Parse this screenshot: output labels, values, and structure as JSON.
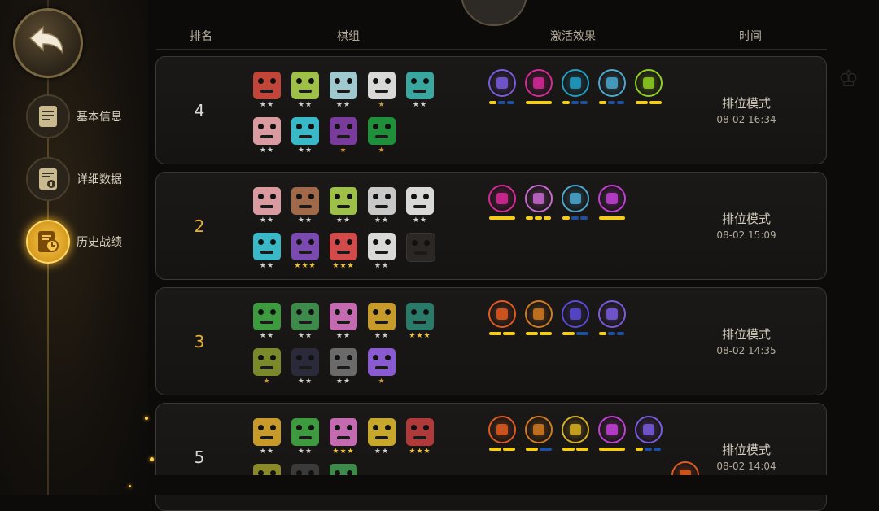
{
  "sidebar": {
    "back": "back",
    "items": [
      {
        "label": "基本信息",
        "icon": "doc-icon",
        "active": false
      },
      {
        "label": "详细数据",
        "icon": "info-doc-icon",
        "active": false
      },
      {
        "label": "历史战绩",
        "icon": "history-icon",
        "active": true
      }
    ]
  },
  "headers": {
    "rank": "排名",
    "lineup": "棋组",
    "synergy": "激活效果",
    "time": "时间"
  },
  "colors": {
    "accent_gold": "#f0b02a",
    "rank_gold": "#e4b032",
    "bar_yellow": "#f3cd1a",
    "bar_blue": "#1f4f9f"
  },
  "matches": [
    {
      "rank": "4",
      "highlight": false,
      "mode": "排位模式",
      "time": "08-02 16:34",
      "pieces": [
        {
          "c": "#c2453a",
          "stars": "★★",
          "star_color": "#cfcfcf"
        },
        {
          "c": "#9fc048",
          "stars": "★★",
          "star_color": "#cfcfcf"
        },
        {
          "c": "#9fc9cf",
          "stars": "★★",
          "star_color": "#cfcfcf"
        },
        {
          "c": "#d9dad8",
          "stars": "★",
          "star_color": "#c8913a"
        },
        {
          "c": "#3aa6a0",
          "stars": "★★",
          "star_color": "#cfcfcf"
        },
        {
          "c": "#d99aa0",
          "stars": "★★",
          "star_color": "#cfcfcf"
        },
        {
          "c": "#39b8c8",
          "stars": "★★",
          "star_color": "#cfcfcf"
        },
        {
          "c": "#7a3c9c",
          "stars": "★",
          "star_color": "#c8913a"
        },
        {
          "c": "#1f8f3a",
          "stars": "★",
          "star_color": "#c8913a"
        }
      ],
      "synergies": [
        {
          "icon": "tablet-icon",
          "color": "#7a5be0",
          "bars": [
            1,
            0,
            0
          ]
        },
        {
          "icon": "claw-icon",
          "color": "#d8289a",
          "bars": [
            1
          ]
        },
        {
          "icon": "swirl-icon",
          "color": "#1fa0c8",
          "bars": [
            1,
            0,
            0
          ]
        },
        {
          "icon": "helm-icon",
          "color": "#4aa8d0",
          "bars": [
            1,
            0,
            0
          ]
        },
        {
          "icon": "trefoil-icon",
          "color": "#8fd01f",
          "bars": [
            1,
            1
          ]
        }
      ]
    },
    {
      "rank": "2",
      "highlight": true,
      "mode": "排位模式",
      "time": "08-02 15:09",
      "pieces": [
        {
          "c": "#d99aa0",
          "stars": "★★",
          "star_color": "#cfcfcf"
        },
        {
          "c": "#a06a4a",
          "stars": "★★",
          "star_color": "#cfcfcf"
        },
        {
          "c": "#9fc048",
          "stars": "★★",
          "star_color": "#cfcfcf"
        },
        {
          "c": "#c8c8c8",
          "stars": "★★",
          "star_color": "#cfcfcf"
        },
        {
          "c": "#d9dad8",
          "stars": "★★",
          "star_color": "#cfcfcf"
        },
        {
          "c": "#39b8c8",
          "stars": "★★",
          "star_color": "#cfcfcf"
        },
        {
          "c": "#7a4ab0",
          "stars": "★★★",
          "star_color": "#f0c230"
        },
        {
          "c": "#d24a4a",
          "stars": "★★★",
          "star_color": "#f0c230"
        },
        {
          "c": "#d9dad8",
          "stars": "★★",
          "star_color": "#cfcfcf"
        },
        {
          "c": "#2a2724",
          "stars": "",
          "star_color": "#cfcfcf"
        }
      ],
      "synergies": [
        {
          "icon": "claw-icon",
          "color": "#d8289a",
          "bars": [
            1
          ]
        },
        {
          "icon": "knight-icon",
          "color": "#c86ad0",
          "bars": [
            1,
            1,
            1
          ]
        },
        {
          "icon": "helm-icon",
          "color": "#4aa8d0",
          "bars": [
            1,
            0,
            0
          ]
        },
        {
          "icon": "skull-icon",
          "color": "#c43fd8",
          "bars": [
            1
          ]
        }
      ]
    },
    {
      "rank": "3",
      "highlight": true,
      "mode": "排位模式",
      "time": "08-02 14:35",
      "pieces": [
        {
          "c": "#3e9a3e",
          "stars": "★★",
          "star_color": "#cfcfcf"
        },
        {
          "c": "#3e8a4a",
          "stars": "★★",
          "star_color": "#cfcfcf"
        },
        {
          "c": "#c46ab0",
          "stars": "★★",
          "star_color": "#cfcfcf"
        },
        {
          "c": "#c89a2a",
          "stars": "★★",
          "star_color": "#cfcfcf"
        },
        {
          "c": "#2a7a6a",
          "stars": "★★★",
          "star_color": "#f0c230"
        },
        {
          "c": "#7a8a2a",
          "stars": "★",
          "star_color": "#c8913a"
        },
        {
          "c": "#2a2a3a",
          "stars": "★★",
          "star_color": "#cfcfcf"
        },
        {
          "c": "#6a6a6a",
          "stars": "★★",
          "star_color": "#cfcfcf"
        },
        {
          "c": "#8a5ad0",
          "stars": "★",
          "star_color": "#c8913a"
        }
      ],
      "synergies": [
        {
          "icon": "mask-icon",
          "color": "#e05a1f",
          "bars": [
            1,
            1
          ]
        },
        {
          "icon": "gear-icon",
          "color": "#d27a1f",
          "bars": [
            1,
            1
          ]
        },
        {
          "icon": "fish-icon",
          "color": "#5a4ad8",
          "bars": [
            1,
            0
          ]
        },
        {
          "icon": "tablet-icon",
          "color": "#7a5be0",
          "bars": [
            1,
            0,
            0
          ]
        }
      ]
    },
    {
      "rank": "5",
      "highlight": false,
      "mode": "排位模式",
      "time": "08-02 14:04",
      "pieces": [
        {
          "c": "#c89a2a",
          "stars": "★★",
          "star_color": "#cfcfcf"
        },
        {
          "c": "#3e9a3e",
          "stars": "★★",
          "star_color": "#cfcfcf"
        },
        {
          "c": "#c46ab0",
          "stars": "★★★",
          "star_color": "#f0c230"
        },
        {
          "c": "#c8a82a",
          "stars": "★★",
          "star_color": "#cfcfcf"
        },
        {
          "c": "#b03a3a",
          "stars": "★★★",
          "star_color": "#f0c230"
        },
        {
          "c": "#8a8a2a",
          "stars": "",
          "star_color": "#cfcfcf"
        },
        {
          "c": "#3a3a3a",
          "stars": "",
          "star_color": "#cfcfcf"
        },
        {
          "c": "#3e8a4a",
          "stars": "",
          "star_color": "#cfcfcf"
        }
      ],
      "synergies": [
        {
          "icon": "mask-icon",
          "color": "#e05a1f",
          "bars": [
            1,
            1
          ]
        },
        {
          "icon": "gear-icon",
          "color": "#d27a1f",
          "bars": [
            1,
            0
          ]
        },
        {
          "icon": "swords-icon",
          "color": "#d8b01f",
          "bars": [
            1,
            1
          ]
        },
        {
          "icon": "skull-icon",
          "color": "#c43fd8",
          "bars": [
            1
          ]
        },
        {
          "icon": "tablet-icon",
          "color": "#7a5be0",
          "bars": [
            1,
            0,
            0
          ]
        },
        {
          "icon": "mask-icon",
          "color": "#e05a1f",
          "bars": []
        }
      ]
    }
  ]
}
